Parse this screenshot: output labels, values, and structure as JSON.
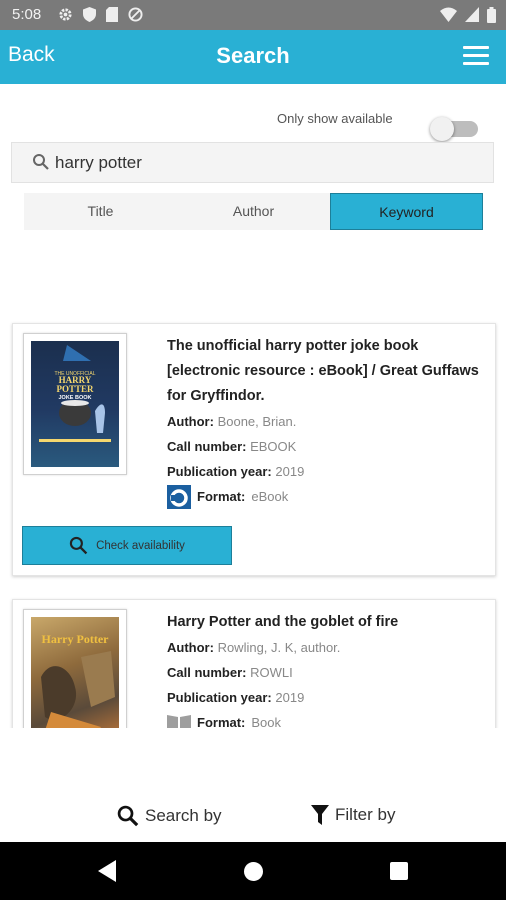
{
  "status_bar": {
    "time": "5:08",
    "left_icons": [
      "gear-icon",
      "shield-icon",
      "sim-icon",
      "do-not-disturb-icon"
    ],
    "right_icons": [
      "wifi-icon",
      "signal-icon",
      "battery-icon"
    ]
  },
  "header": {
    "back_label": "Back",
    "title": "Search",
    "menu_icon": "hamburger-menu-icon",
    "color": "#29b0d4"
  },
  "filters": {
    "only_available_label": "Only show available",
    "only_available_on": false
  },
  "search": {
    "value": "harry potter",
    "icon": "search-icon"
  },
  "search_type": {
    "tabs": [
      "Title",
      "Author",
      "Keyword"
    ],
    "selected": "Keyword"
  },
  "results": [
    {
      "title": "The unofficial harry potter joke book [electronic resource : eBook] / Great Guffaws for Gryffindor.",
      "author_label": "Author:",
      "author": "Boone, Brian.",
      "call_label": "Call number:",
      "call_number": "EBOOK",
      "year_label": "Publication year:",
      "year": "2019",
      "format_label": "Format:",
      "format": "eBook",
      "format_icon": "ebook-format-icon",
      "cover_text": {
        "top": "THE UNOFFICIAL",
        "harry": "HARRY",
        "potter": "POTTER",
        "joke": "JOKE BOOK"
      },
      "check_label": "Check availability"
    },
    {
      "title": "Harry Potter and the goblet of fire",
      "author_label": "Author:",
      "author": "Rowling, J. K, author.",
      "call_label": "Call number:",
      "call_number": "ROWLI",
      "year_label": "Publication year:",
      "year": "2019",
      "format_label": "Format:",
      "format": "Book",
      "format_icon": "book-format-icon",
      "cover_text": {
        "title": "Harry Potter"
      }
    }
  ],
  "bottom_bar": {
    "search_by": "Search by",
    "filter_by": "Filter by"
  },
  "nav_bar": [
    "back-icon",
    "home-icon",
    "recents-icon"
  ]
}
